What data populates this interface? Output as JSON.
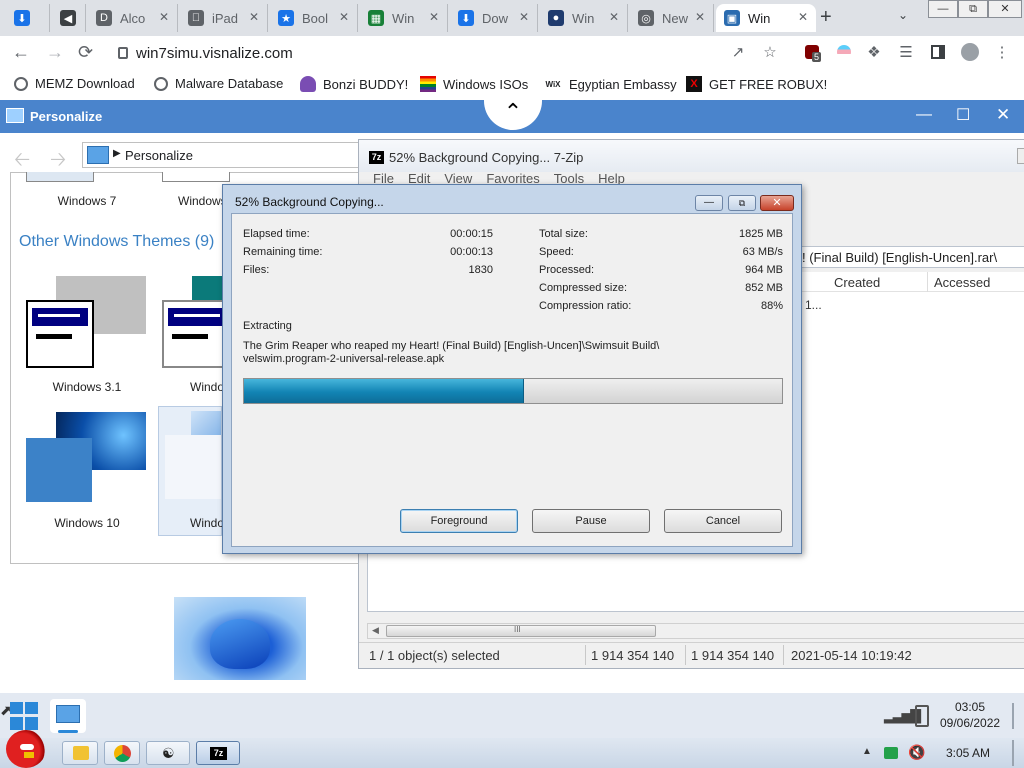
{
  "browser": {
    "tabs": [
      {
        "label": "",
        "icon": "download-icon",
        "color": "#1a73e8"
      },
      {
        "label": "",
        "icon": "speaker-icon",
        "color": "#3c4043"
      },
      {
        "label": "Alco",
        "icon": "d-icon",
        "color": "#5f6368"
      },
      {
        "label": "iPad",
        "icon": "apple-icon",
        "color": "#5f6368"
      },
      {
        "label": "Bool",
        "icon": "star-icon",
        "color": "#1a73e8"
      },
      {
        "label": "Win",
        "icon": "sheet-icon",
        "color": "#188038"
      },
      {
        "label": "Dow",
        "icon": "download-icon",
        "color": "#1a73e8"
      },
      {
        "label": "Win",
        "icon": "globe-icon",
        "color": "#1f3b6e"
      },
      {
        "label": "New",
        "icon": "chrome-icon",
        "color": "#5f6368"
      },
      {
        "label": "Win",
        "icon": "windows-icon",
        "color": "#2b6cb0"
      }
    ],
    "new_tab": "+",
    "url": "win7simu.visnalize.com",
    "extension_badge": "5",
    "bookmarks": [
      {
        "label": "MEMZ Download",
        "icon": "globe-icon"
      },
      {
        "label": "Malware Database",
        "icon": "globe-icon"
      },
      {
        "label": "Bonzi BUDDY!",
        "icon": "bonzi-icon"
      },
      {
        "label": "Windows ISOs",
        "icon": "pride-flag-icon"
      },
      {
        "label": "Egyptian Embassy",
        "icon": "wix-icon",
        "icon_text": "WiX"
      },
      {
        "label": "GET FREE ROBUX!",
        "icon": "x-icon",
        "icon_text": "X"
      }
    ]
  },
  "sim": {
    "title": "Personalize",
    "breadcrumb": "Personalize",
    "themes_top": [
      {
        "label": "Windows 7"
      },
      {
        "label": "Windows"
      }
    ],
    "other_heading": "Other Windows Themes (9)",
    "themes": [
      {
        "label": "Windows 3.1"
      },
      {
        "label": "Windo"
      },
      {
        "label": "Windows 10"
      },
      {
        "label": "Windo"
      }
    ]
  },
  "zip": {
    "title": "52% Background Copying... 7-Zip",
    "icon_text": "7z",
    "menu": [
      "File",
      "Edit",
      "View",
      "Favorites",
      "Tools",
      "Help"
    ],
    "path_text": "! (Final Build) [English-Uncen].rar\\",
    "columns": [
      "Created",
      "Accessed"
    ],
    "row_fragment": "1...",
    "scroll_grip": "III",
    "status": [
      "1 / 1 object(s) selected",
      "1 914 354 140",
      "1 914 354 140",
      "2021-05-14 10:19:42"
    ]
  },
  "dialog": {
    "title": "52% Background Copying...",
    "progress_percent": 52,
    "left_stats": [
      {
        "label": "Elapsed time:",
        "value": "00:00:15"
      },
      {
        "label": "Remaining time:",
        "value": "00:00:13"
      },
      {
        "label": "Files:",
        "value": "1830"
      }
    ],
    "right_stats": [
      {
        "label": "Total size:",
        "value": "1825 MB"
      },
      {
        "label": "Speed:",
        "value": "63 MB/s"
      },
      {
        "label": "Processed:",
        "value": "964 MB"
      },
      {
        "label": "Compressed size:",
        "value": "852 MB"
      },
      {
        "label": "Compression ratio:",
        "value": "88%"
      }
    ],
    "action": "Extracting",
    "file_line1": "The Grim Reaper who reaped my Heart! (Final Build) [English-Uncen]\\Swimsuit Build\\",
    "file_line2": "velswim.program-2-universal-release.apk",
    "buttons": {
      "foreground": "Foreground",
      "pause": "Pause",
      "cancel": "Cancel"
    }
  },
  "taskbar": {
    "time": "03:05",
    "date": "09/06/2022",
    "host_time": "3:05 AM",
    "zip_label": "7z"
  }
}
